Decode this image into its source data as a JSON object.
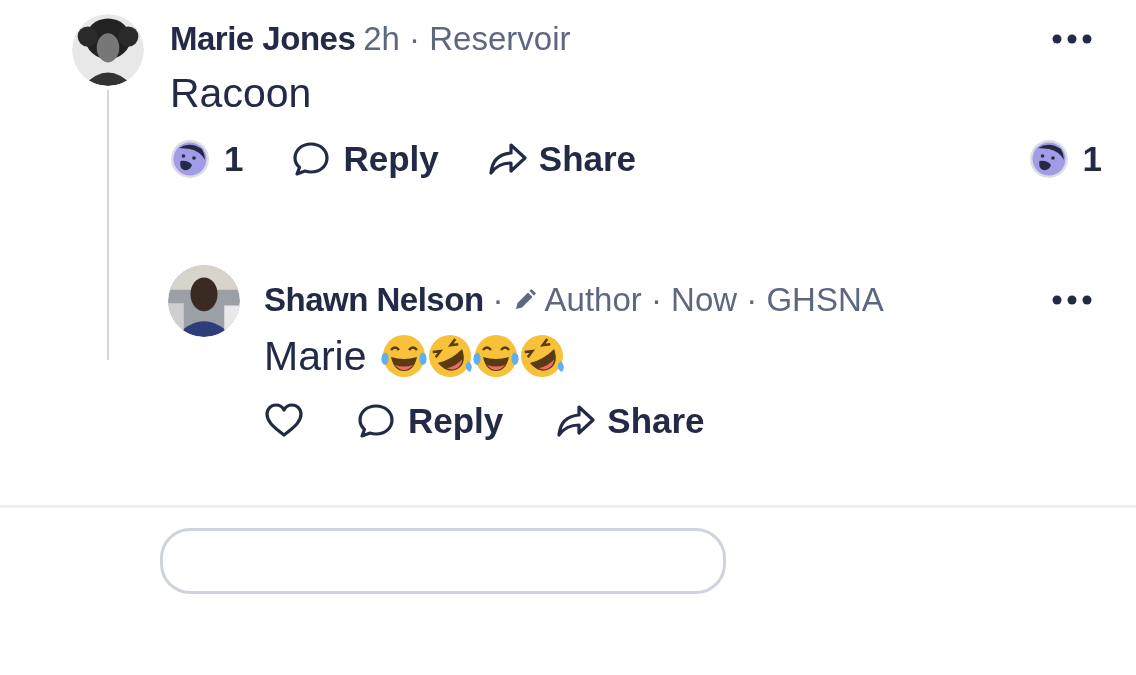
{
  "comments": [
    {
      "author": "Marie Jones",
      "meta": "2h · Reservoir",
      "text": "Racoon",
      "reaction_count": "1",
      "actions": [
        "Reply",
        "Share"
      ],
      "side_reaction_count": "1",
      "replies": [
        {
          "author": "Shawn Nelson",
          "separator": "·",
          "meta": "Author · Now · GHSNA",
          "author_badge": true,
          "text": "Marie",
          "emojis": [
            {
              "kind": "joy"
            },
            {
              "kind": "rofl"
            },
            {
              "kind": "joy"
            },
            {
              "kind": "rofl"
            }
          ],
          "liked": false,
          "actions": [
            "Reply",
            "Share"
          ]
        }
      ]
    }
  ]
}
